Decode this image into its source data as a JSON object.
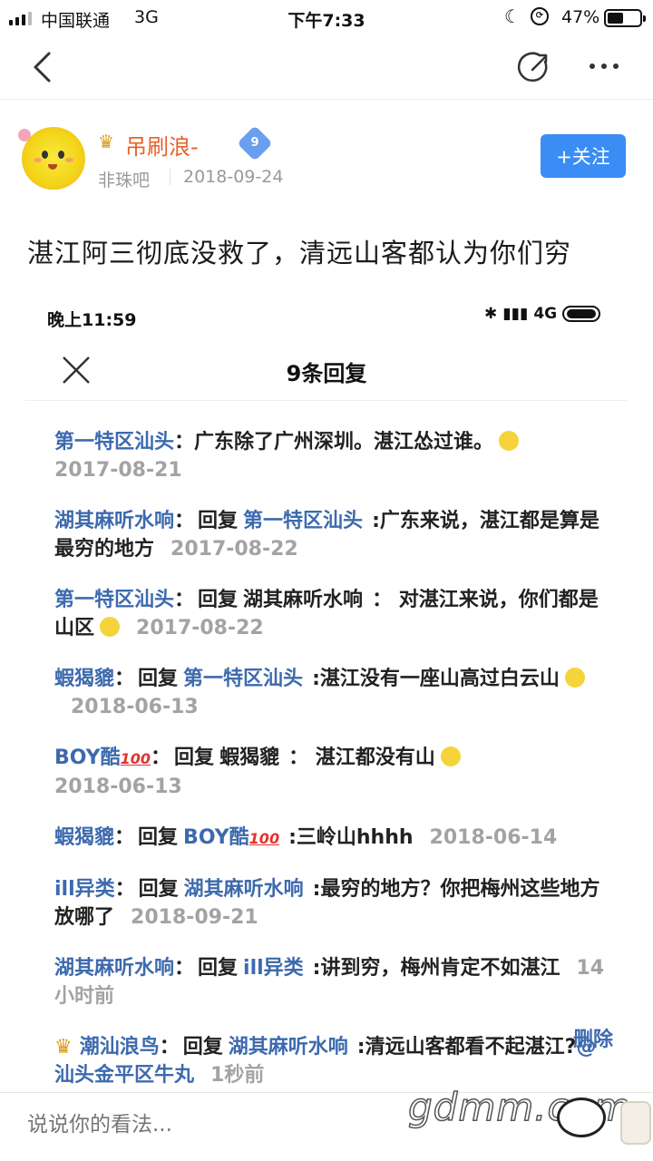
{
  "status_bar": {
    "carrier": "中国联通",
    "network": "3G",
    "time": "下午7:33",
    "battery_percent": "47%",
    "battery_level": 0.47
  },
  "nav": {
    "back_icon": "chevron-left-icon",
    "share_icon": "share-icon",
    "more_icon": "more-dots-icon"
  },
  "post": {
    "author": "吊刷浪-",
    "level": "9",
    "forum": "非珠吧",
    "date": "2018-09-24",
    "follow_label": "+关注",
    "title": "湛江阿三彻底没救了，清远山客都认为你们穷"
  },
  "screenshot": {
    "status_time": "晚上11:59",
    "status_net": "4G",
    "header_title": "9条回复",
    "replies": [
      {
        "user": "第一特区汕头",
        "reply_word": "",
        "target": "",
        "text": "广东除了广州深圳。湛江怂过谁。",
        "emoji": true,
        "date": "2017-08-21"
      },
      {
        "user": "湖其麻听水响",
        "reply_word": "回复",
        "target": "第一特区汕头",
        "text": ":广东来说，湛江都是算是最穷的地方",
        "emoji": false,
        "date": "2017-08-22"
      },
      {
        "user": "第一特区汕头",
        "reply_word": "回复",
        "target": "湖其麻听水响",
        "text": "： 对湛江来说，你们都是山区",
        "emoji": true,
        "date": "2017-08-22"
      },
      {
        "user": "蝦猲貔",
        "reply_word": "回复",
        "target": "第一特区汕头",
        "text": ":湛江没有一座山高过白云山",
        "emoji": true,
        "date": "2018-06-13"
      },
      {
        "user": "BOY酷",
        "user_badge": "100",
        "reply_word": "回复",
        "target": "蝦猲貔",
        "text": "： 湛江都没有山",
        "emoji": true,
        "date": "2018-06-13"
      },
      {
        "user": "蝦猲貔",
        "reply_word": "回复",
        "target": "BOY酷",
        "target_badge": "100",
        "text": ":三岭山hhhh",
        "emoji": false,
        "date": "2018-06-14"
      },
      {
        "user": "ill异类",
        "reply_word": "回复",
        "target": "湖其麻听水响",
        "text": ":最穷的地方？你把梅州这些地方放哪了",
        "emoji": false,
        "date": "2018-09-21"
      },
      {
        "user": "湖其麻听水响",
        "reply_word": "回复",
        "target": "ill异类",
        "text": ":讲到穷，梅州肯定不如湛江",
        "emoji": false,
        "date": "14小时前"
      },
      {
        "user": "潮汕浪鸟",
        "reply_word": "回复",
        "target": "湖其麻听水响",
        "text": ":清远山客都看不起湛江?",
        "mention": "@汕头金平区牛丸",
        "emoji": false,
        "date": "1秒前",
        "delete_label": "删除"
      }
    ]
  },
  "comment_bar": {
    "placeholder": "说说你的看法..."
  },
  "watermark": "gdmm.com",
  "colors": {
    "accent": "#3b8cf5",
    "username": "#3d6aae",
    "author": "#e8622a",
    "date": "#a3a3a3"
  }
}
